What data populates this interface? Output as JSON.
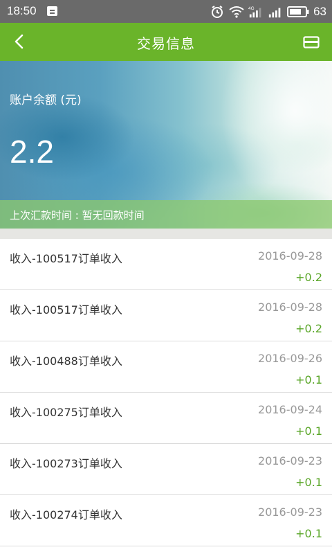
{
  "status_bar": {
    "time": "18:50",
    "battery": "63",
    "network": "4G"
  },
  "app_bar": {
    "title": "交易信息"
  },
  "balance": {
    "label": "账户余额 (元)",
    "value": "2.2",
    "last_remit": "上次汇款时间 : 暂无回款时间"
  },
  "transactions": [
    {
      "desc": "收入-100517订单收入",
      "date": "2016-09-28",
      "amount": "+0.2"
    },
    {
      "desc": "收入-100517订单收入",
      "date": "2016-09-28",
      "amount": "+0.2"
    },
    {
      "desc": "收入-100488订单收入",
      "date": "2016-09-26",
      "amount": "+0.1"
    },
    {
      "desc": "收入-100275订单收入",
      "date": "2016-09-24",
      "amount": "+0.1"
    },
    {
      "desc": "收入-100273订单收入",
      "date": "2016-09-23",
      "amount": "+0.1"
    },
    {
      "desc": "收入-100274订单收入",
      "date": "2016-09-23",
      "amount": "+0.1"
    }
  ],
  "colors": {
    "app_bar": "#6ab42a",
    "amount": "#5aa628",
    "status_bar": "#6a6a6a"
  }
}
